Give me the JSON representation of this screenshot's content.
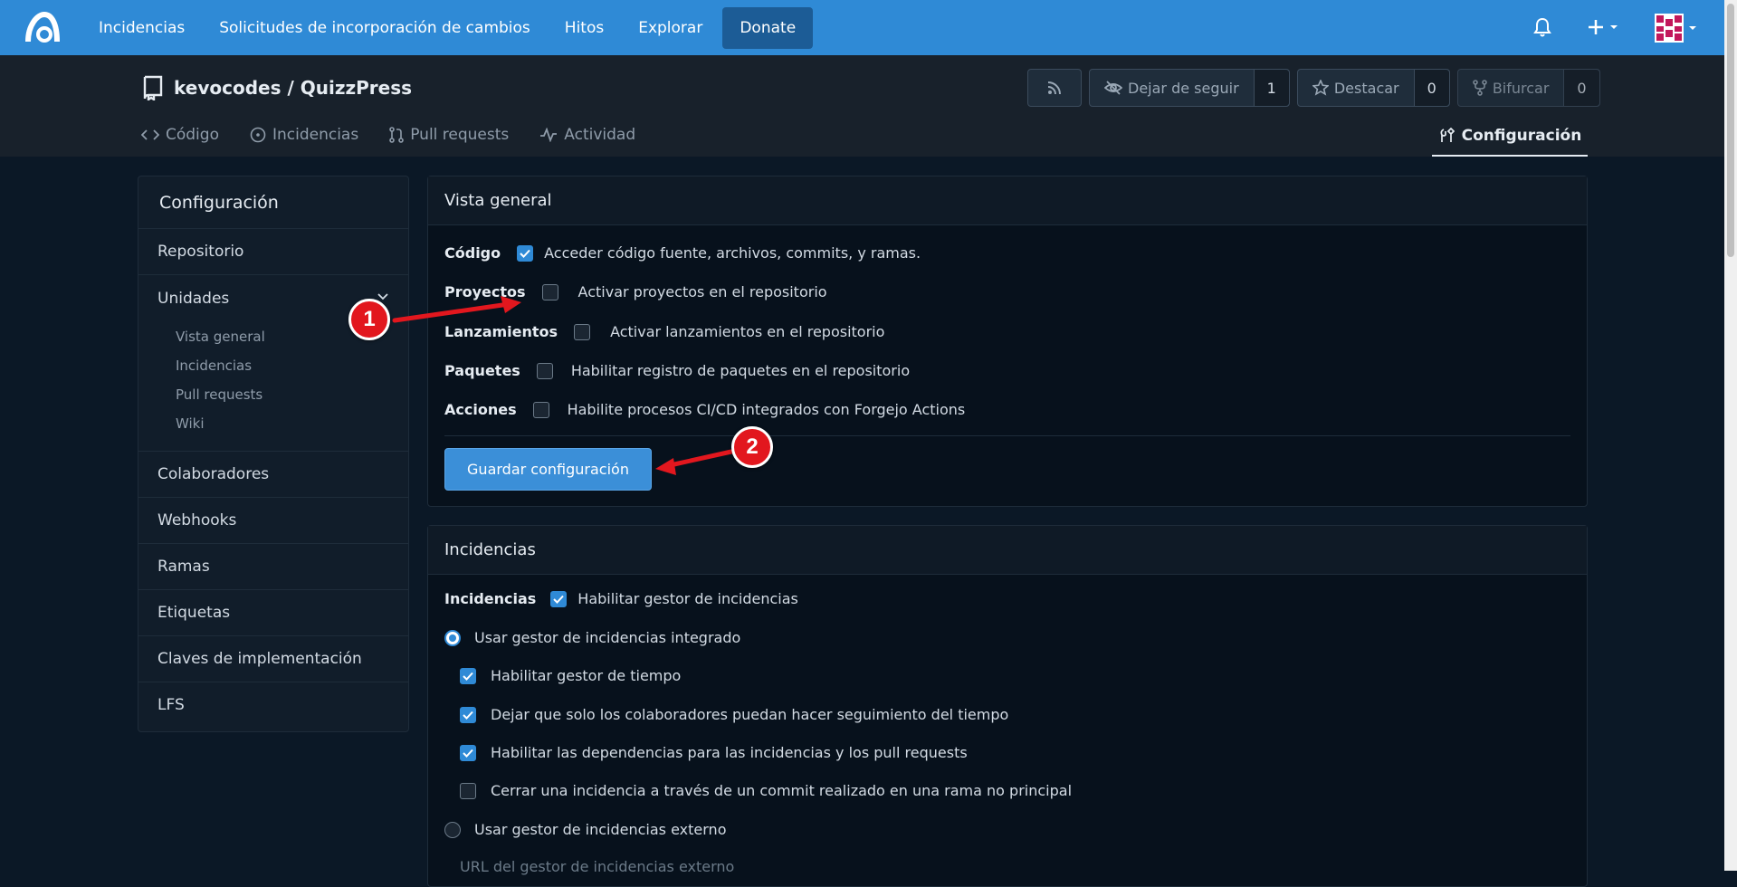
{
  "navbar": {
    "links": [
      "Incidencias",
      "Solicitudes de incorporación de cambios",
      "Hitos",
      "Explorar",
      "Donate"
    ]
  },
  "repo": {
    "owner": "kevocodes",
    "separator": " / ",
    "name": "QuizzPress",
    "unwatch_label": "Dejar de seguir",
    "watch_count": "1",
    "star_label": "Destacar",
    "star_count": "0",
    "fork_label": "Bifurcar",
    "fork_count": "0",
    "tabs": [
      "Código",
      "Incidencias",
      "Pull requests",
      "Actividad"
    ],
    "settings_tab": "Configuración"
  },
  "sidebar": {
    "title": "Configuración",
    "repository": "Repositorio",
    "units": "Unidades",
    "unit_subitems": [
      "Vista general",
      "Incidencias",
      "Pull requests",
      "Wiki"
    ],
    "items": [
      "Colaboradores",
      "Webhooks",
      "Ramas",
      "Etiquetas",
      "Claves de implementación",
      "LFS"
    ]
  },
  "overview": {
    "title": "Vista general",
    "rows": [
      {
        "label": "Código",
        "text": "Acceder código fuente, archivos, commits, y ramas.",
        "checked": true
      },
      {
        "label": "Proyectos",
        "text": "Activar proyectos en el repositorio",
        "checked": false
      },
      {
        "label": "Lanzamientos",
        "text": "Activar lanzamientos en el repositorio",
        "checked": false
      },
      {
        "label": "Paquetes",
        "text": "Habilitar registro de paquetes en el repositorio",
        "checked": false
      },
      {
        "label": "Acciones",
        "text": "Habilite procesos CI/CD integrados con Forgejo Actions",
        "checked": false
      }
    ],
    "save_label": "Guardar configuración"
  },
  "issues": {
    "title": "Incidencias",
    "enable_label": "Incidencias",
    "enable_text": "Habilitar gestor de incidencias",
    "internal_radio": "Usar gestor de incidencias integrado",
    "options": [
      {
        "text": "Habilitar gestor de tiempo",
        "checked": true
      },
      {
        "text": "Dejar que solo los colaboradores puedan hacer seguimiento del tiempo",
        "checked": true
      },
      {
        "text": "Habilitar las dependencias para las incidencias y los pull requests",
        "checked": true
      },
      {
        "text": "Cerrar una incidencia a través de un commit realizado en una rama no principal",
        "checked": false
      }
    ],
    "external_radio": "Usar gestor de incidencias externo",
    "external_url_label": "URL del gestor de incidencias externo"
  },
  "annotations": {
    "badge_1": "1",
    "badge_2": "2"
  },
  "colors": {
    "navbar": "#2f8ad6",
    "accent": "#3b8fd8",
    "annotation": "#e2171e"
  }
}
